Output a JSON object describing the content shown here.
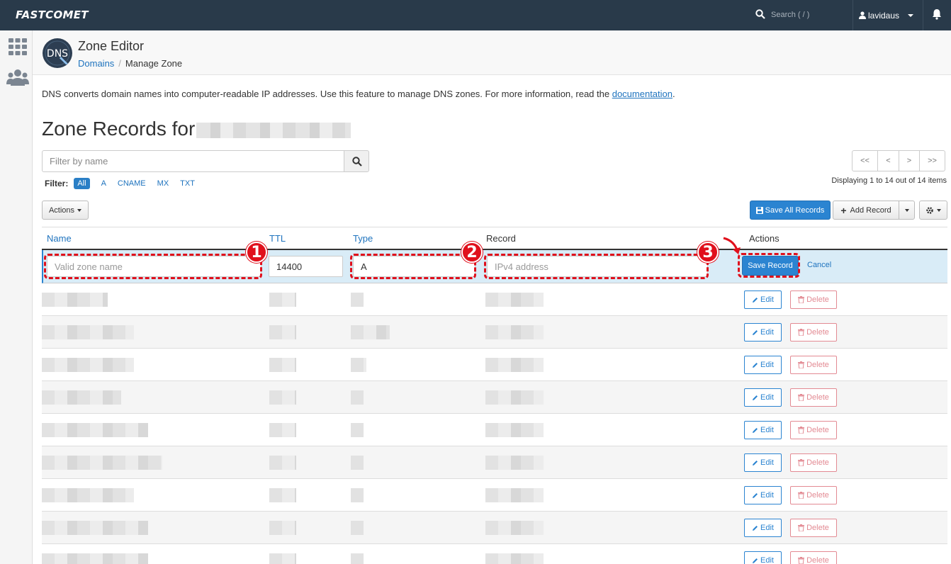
{
  "topbar": {
    "brand": "FASTCOMET",
    "search_placeholder": "Search ( / )",
    "user": "lavidaus"
  },
  "header": {
    "title": "Zone Editor",
    "breadcrumb_parent": "Domains",
    "breadcrumb_current": "Manage Zone"
  },
  "description": {
    "text": "DNS converts domain names into computer-readable IP addresses. Use this feature to manage DNS zones. For more information, read the ",
    "link": "documentation",
    "suffix": "."
  },
  "heading": "Zone Records for",
  "filter": {
    "placeholder": "Filter by name",
    "label": "Filter:",
    "types": [
      "All",
      "A",
      "CNAME",
      "MX",
      "TXT"
    ],
    "active": "All"
  },
  "pagination": {
    "first": "<<",
    "prev": "<",
    "next": ">",
    "last": ">>",
    "info": "Displaying 1 to 14 out of 14 items"
  },
  "toolbar": {
    "actions": "Actions",
    "save_all": "Save All Records",
    "add_record": "Add Record"
  },
  "table": {
    "headers": {
      "name": "Name",
      "ttl": "TTL",
      "type": "Type",
      "record": "Record",
      "actions": "Actions"
    },
    "new_row": {
      "name_placeholder": "Valid zone name",
      "ttl": "14400",
      "type": "A",
      "record_placeholder": "IPv4 address",
      "save": "Save Record",
      "cancel": "Cancel"
    },
    "row_actions": {
      "edit": "Edit",
      "delete": "Delete"
    }
  },
  "callouts": [
    "1",
    "2",
    "3"
  ],
  "colors": {
    "topbar": "#293a4a",
    "primary": "#2b84d1",
    "annotation": "#e0101c",
    "delete": "#e38a93"
  }
}
